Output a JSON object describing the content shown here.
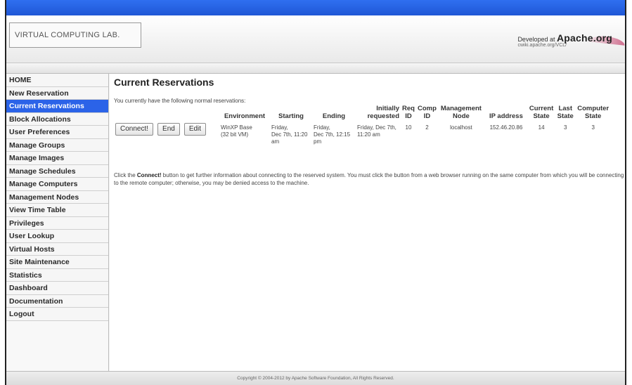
{
  "header": {
    "logo_text": "VIRTUAL COMPUTING LAB.",
    "developed_prefix": "Developed at ",
    "developed_org": "Apache.org",
    "developed_url": "cwiki.apache.org/VCL/"
  },
  "sidebar": {
    "items": [
      {
        "label": "HOME"
      },
      {
        "label": "New Reservation"
      },
      {
        "label": "Current Reservations"
      },
      {
        "label": "Block Allocations"
      },
      {
        "label": "User Preferences"
      },
      {
        "label": "Manage Groups"
      },
      {
        "label": "Manage Images"
      },
      {
        "label": "Manage Schedules"
      },
      {
        "label": "Manage Computers"
      },
      {
        "label": "Management Nodes"
      },
      {
        "label": "View Time Table"
      },
      {
        "label": "Privileges"
      },
      {
        "label": "User Lookup"
      },
      {
        "label": "Virtual Hosts"
      },
      {
        "label": "Site Maintenance"
      },
      {
        "label": "Statistics"
      },
      {
        "label": "Dashboard"
      },
      {
        "label": "Documentation"
      },
      {
        "label": "Logout"
      }
    ],
    "active_index": 2
  },
  "main": {
    "title": "Current Reservations",
    "intro": "You currently have the following normal reservations:",
    "columns": {
      "environment": "Environment",
      "starting": "Starting",
      "ending": "Ending",
      "initially_1": "Initially",
      "initially_2": "requested",
      "req_1": "Req",
      "req_2": "ID",
      "comp_1": "Comp",
      "comp_2": "ID",
      "mgmt_1": "Management",
      "mgmt_2": "Node",
      "ip": "IP address",
      "cur_1": "Current",
      "cur_2": "State",
      "last_1": "Last",
      "last_2": "State",
      "cs_1": "Computer",
      "cs_2": "State"
    },
    "reservation": {
      "connect_label": "Connect!",
      "end_label": "End",
      "edit_label": "Edit",
      "env_1": "WinXP Base",
      "env_2": "(32 bit VM)",
      "start_1": "Friday,",
      "start_2": "Dec 7th, 11:20",
      "start_3": "am",
      "end_1": "Friday,",
      "end_2": "Dec 7th, 12:15",
      "end_3": "pm",
      "req_1": "Friday, Dec 7th,",
      "req_2": "11:20 am",
      "req_id": "10",
      "comp_id": "2",
      "mgmt_node": "localhost",
      "ip": "152.46.20.86",
      "current_state": "14",
      "last_state": "3",
      "computer_state": "3"
    },
    "info_pre": "Click the ",
    "info_bold": "Connect!",
    "info_post": " button to get further information about connecting to the reserved system. You must click the button from a web browser running on the same computer from which you will be connecting to the remote computer; otherwise, you may be denied access to the machine."
  },
  "footer": {
    "text": "Copyright © 2004-2012 by Apache Software Foundation, All Rights Reserved."
  }
}
